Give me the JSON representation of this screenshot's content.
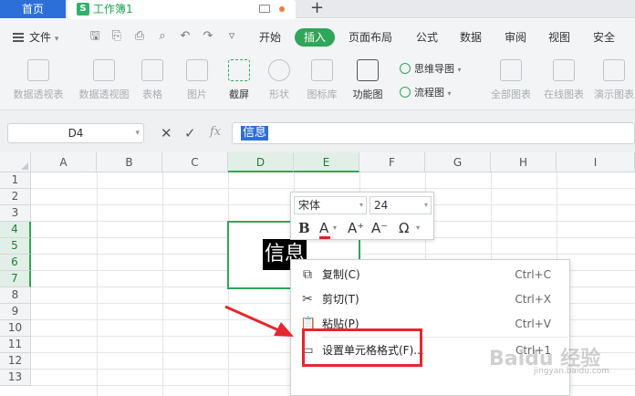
{
  "tabs": {
    "home": "首页",
    "doc": "工作簿1",
    "doc_logo": "S",
    "new_tab": "+"
  },
  "menubar": {
    "file": "文件",
    "items": [
      "开始",
      "插入",
      "页面布局",
      "公式",
      "数据",
      "审阅",
      "视图",
      "安全"
    ],
    "active": "插入"
  },
  "ribbon": {
    "pivot_table": "数据透视表",
    "pivot_chart": "数据透视图",
    "table": "表格",
    "picture": "图片",
    "screenshot": "截屏",
    "shape": "形状",
    "icon_library": "图标库",
    "function_chart": "功能图",
    "mindmap": "思维导图",
    "flowchart": "流程图",
    "all_charts": "全部图表",
    "online_charts": "在线图表",
    "demo_charts": "演示图表"
  },
  "formula_bar": {
    "name_box": "D4",
    "fx": "fx",
    "value": "信息"
  },
  "grid": {
    "columns": [
      "A",
      "B",
      "C",
      "D",
      "E",
      "F",
      "G",
      "H",
      "I"
    ],
    "rows": [
      "1",
      "2",
      "3",
      "4",
      "5",
      "6",
      "7",
      "8",
      "9",
      "10",
      "11",
      "12",
      "13"
    ],
    "cell_text": "信息",
    "selected_columns": [
      "D",
      "E"
    ],
    "selected_rows": [
      "4",
      "5",
      "6",
      "7"
    ]
  },
  "mini_toolbar": {
    "font": "宋体",
    "size": "24",
    "bold": "B",
    "font_color": "A",
    "grow": "A⁺",
    "shrink": "A⁻",
    "symbol": "Ω"
  },
  "context_menu": {
    "items": [
      {
        "label": "复制(C)",
        "shortcut": "Ctrl+C",
        "icon": "copy-icon"
      },
      {
        "label": "剪切(T)",
        "shortcut": "Ctrl+X",
        "icon": "scissors-icon"
      },
      {
        "label": "粘贴(P)",
        "shortcut": "Ctrl+V",
        "icon": "paste-icon"
      },
      {
        "label": "设置单元格格式(F)...",
        "shortcut": "Ctrl+1",
        "icon": "format-cells-icon"
      }
    ]
  },
  "watermark": {
    "main": "Baidu 经验",
    "sub": "jingyan.baidu.com"
  },
  "colors": {
    "accent": "#2fa658",
    "annotation": "#e3282e",
    "home_tab": "#2d6fd8"
  }
}
